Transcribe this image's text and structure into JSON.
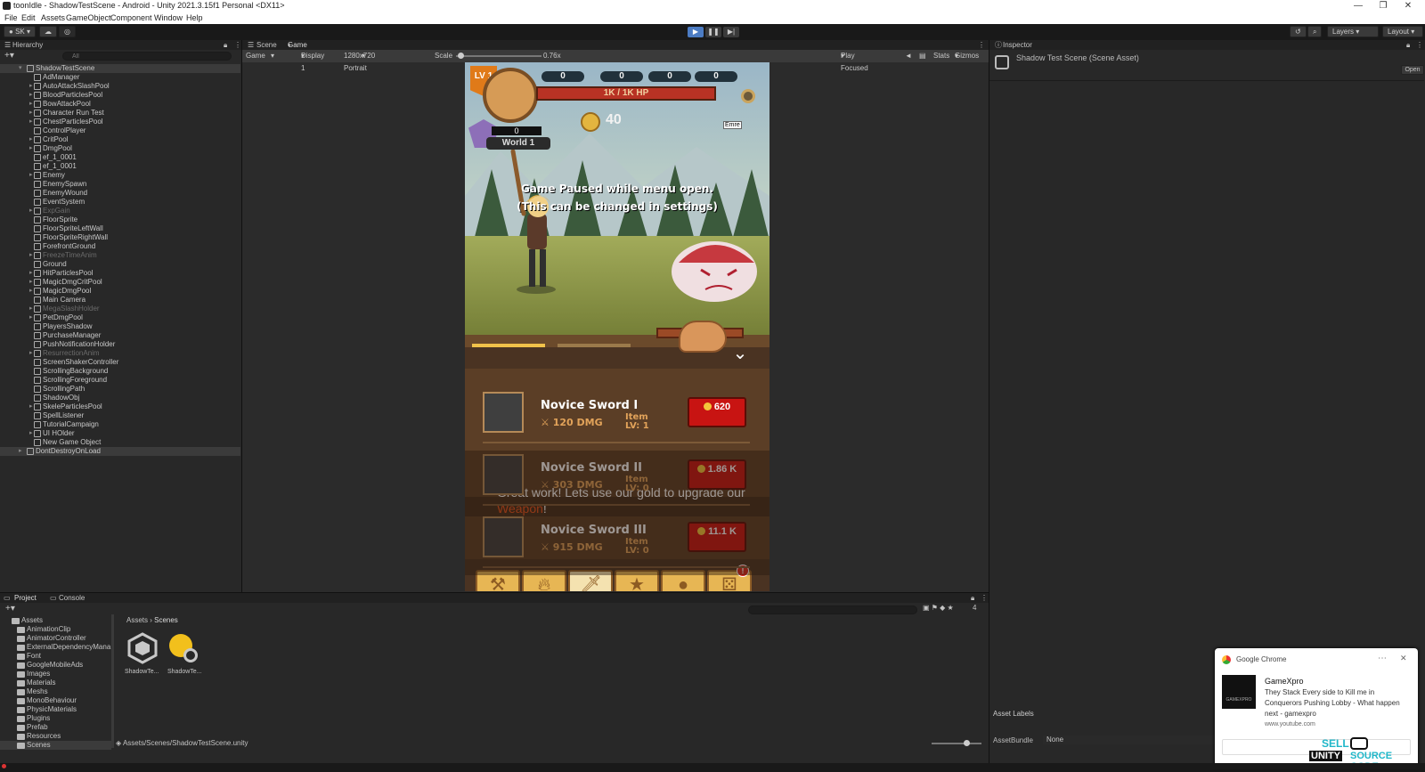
{
  "window": {
    "title": "toonIdle - ShadowTestScene - Android - Unity 2021.3.15f1 Personal <DX11>"
  },
  "menu": [
    "File",
    "Edit",
    "Assets",
    "GameObject",
    "Component",
    "Window",
    "Help"
  ],
  "toolbar": {
    "account": "SK",
    "layers": "Layers",
    "layout": "Layout"
  },
  "hierarchy": {
    "tab": "Hierarchy",
    "search_placeholder": "All",
    "root": "ShadowTestScene",
    "items": [
      {
        "name": "AdManager",
        "expand": false,
        "disabled": false
      },
      {
        "name": "AutoAttackSlashPool",
        "expand": true,
        "disabled": false
      },
      {
        "name": "BloodParticlesPool",
        "expand": true,
        "disabled": false
      },
      {
        "name": "BowAttackPool",
        "expand": true,
        "disabled": false
      },
      {
        "name": "Character Run Test",
        "expand": true,
        "disabled": false
      },
      {
        "name": "ChestParticlesPool",
        "expand": true,
        "disabled": false
      },
      {
        "name": "ControlPlayer",
        "expand": false,
        "disabled": false
      },
      {
        "name": "CritPool",
        "expand": true,
        "disabled": false
      },
      {
        "name": "DmgPool",
        "expand": true,
        "disabled": false
      },
      {
        "name": "ef_1_0001",
        "expand": false,
        "disabled": false
      },
      {
        "name": "ef_1_0001",
        "expand": false,
        "disabled": false
      },
      {
        "name": "Enemy",
        "expand": true,
        "disabled": false
      },
      {
        "name": "EnemySpawn",
        "expand": false,
        "disabled": false
      },
      {
        "name": "EnemyWound",
        "expand": false,
        "disabled": false
      },
      {
        "name": "EventSystem",
        "expand": false,
        "disabled": false
      },
      {
        "name": "ExpGain",
        "expand": true,
        "disabled": true
      },
      {
        "name": "FloorSprite",
        "expand": false,
        "disabled": false
      },
      {
        "name": "FloorSpriteLeftWall",
        "expand": false,
        "disabled": false
      },
      {
        "name": "FloorSpriteRightWall",
        "expand": false,
        "disabled": false
      },
      {
        "name": "ForefrontGround",
        "expand": false,
        "disabled": false
      },
      {
        "name": "FreezeTimeAnim",
        "expand": true,
        "disabled": true
      },
      {
        "name": "Ground",
        "expand": false,
        "disabled": false
      },
      {
        "name": "HitParticlesPool",
        "expand": true,
        "disabled": false
      },
      {
        "name": "MagicDmgCritPool",
        "expand": true,
        "disabled": false
      },
      {
        "name": "MagicDmgPool",
        "expand": true,
        "disabled": false
      },
      {
        "name": "Main Camera",
        "expand": false,
        "disabled": false
      },
      {
        "name": "MegaSlashHolder",
        "expand": true,
        "disabled": true
      },
      {
        "name": "PetDmgPool",
        "expand": true,
        "disabled": false
      },
      {
        "name": "PlayersShadow",
        "expand": false,
        "disabled": false
      },
      {
        "name": "PurchaseManager",
        "expand": false,
        "disabled": false
      },
      {
        "name": "PushNotificationHolder",
        "expand": false,
        "disabled": false
      },
      {
        "name": "ResurrectionAnim",
        "expand": true,
        "disabled": true
      },
      {
        "name": "ScreenShakerController",
        "expand": false,
        "disabled": false
      },
      {
        "name": "ScrollingBackground",
        "expand": false,
        "disabled": false
      },
      {
        "name": "ScrollingForeground",
        "expand": false,
        "disabled": false
      },
      {
        "name": "ScrollingPath",
        "expand": false,
        "disabled": false
      },
      {
        "name": "ShadowObj",
        "expand": false,
        "disabled": false
      },
      {
        "name": "SkeleParticlesPool",
        "expand": true,
        "disabled": false
      },
      {
        "name": "SpellListener",
        "expand": false,
        "disabled": false
      },
      {
        "name": "TutorialCampaign",
        "expand": false,
        "disabled": false
      },
      {
        "name": "UI HOlder",
        "expand": true,
        "disabled": false
      },
      {
        "name": "New Game Object",
        "expand": false,
        "disabled": false
      }
    ],
    "root2": "DontDestroyOnLoad"
  },
  "gameview": {
    "tab_scene": "Scene",
    "tab_game": "Game",
    "mode": "Game",
    "display": "Display 1",
    "resolution": "1280x720 Portrait",
    "scale_label": "Scale",
    "scale_value": "0.76x",
    "play_focused": "Play Focused",
    "stats": "Stats",
    "gizmos": "Gizmos"
  },
  "game": {
    "level": "LV 1",
    "counters": [
      "0",
      "0",
      "0",
      "0"
    ],
    "hp": "1K / 1K HP",
    "gold": "40",
    "stage_count": "0",
    "world": "World 1",
    "cursor_tooltip": "Emre",
    "pause_line1": "Game Paused while menu open.",
    "pause_line2": "(This can be changed in settings)",
    "tutorial_before": "Great work! Lets use our gold to upgrade our ",
    "tutorial_highlight": "Weapon",
    "tutorial_after": "!",
    "items": [
      {
        "name": "Novice Sword I",
        "dmg": "120 DMG",
        "lv1": "Item",
        "lv2": "LV: 1",
        "price": "620"
      },
      {
        "name": "Novice Sword II",
        "dmg": "303 DMG",
        "lv1": "Item",
        "lv2": "LV: 0",
        "price": "1.86 K"
      },
      {
        "name": "Novice Sword III",
        "dmg": "915 DMG",
        "lv1": "Item",
        "lv2": "LV: 0",
        "price": "11.1 K"
      }
    ],
    "nav_icons": [
      "hammer-icon",
      "fire-icon",
      "sword-icon",
      "star-icon",
      "bag-icon",
      "dice-icon"
    ],
    "nav_badge": "!"
  },
  "inspector": {
    "tab": "Inspector",
    "title": "Shadow Test Scene (Scene Asset)",
    "open": "Open",
    "asset_labels": "Asset Labels",
    "asset_bundle": "AssetBundle",
    "asset_bundle_value": "None"
  },
  "project": {
    "tab_project": "Project",
    "tab_console": "Console",
    "breadcrumb_root": "Assets",
    "breadcrumb_leaf": "Scenes",
    "count": "4",
    "tree_root": "Assets",
    "folders": [
      "AnimationClip",
      "AnimatorController",
      "ExternalDependencyMana",
      "Font",
      "GoogleMobileAds",
      "Images",
      "Materials",
      "Meshs",
      "MonoBehaviour",
      "PhysicMaterials",
      "Plugins",
      "Prefab",
      "Resources",
      "Scenes"
    ],
    "assets": [
      "ShadowTe...",
      "ShadowTe..."
    ],
    "path": "Assets/Scenes/ShadowTestScene.unity"
  },
  "notification": {
    "app": "Google Chrome",
    "title": "GameXpro",
    "body": "They Stack Every side to Kill me in Conquerors Pushing Lobby - What happen next - gamexpro",
    "url": "www.youtube.com",
    "icon_text": "GAMEXPRO"
  },
  "watermark": {
    "line1": "SELL",
    "line2a": "UNITY",
    "line2b": "SOURCE CODE"
  },
  "colors": {
    "accent": "#4c7cc3",
    "selected_row": "#3b3b3b",
    "price_button": "#c81412",
    "gold": "#f3c53b",
    "weapon_highlight": "#e8531d"
  }
}
